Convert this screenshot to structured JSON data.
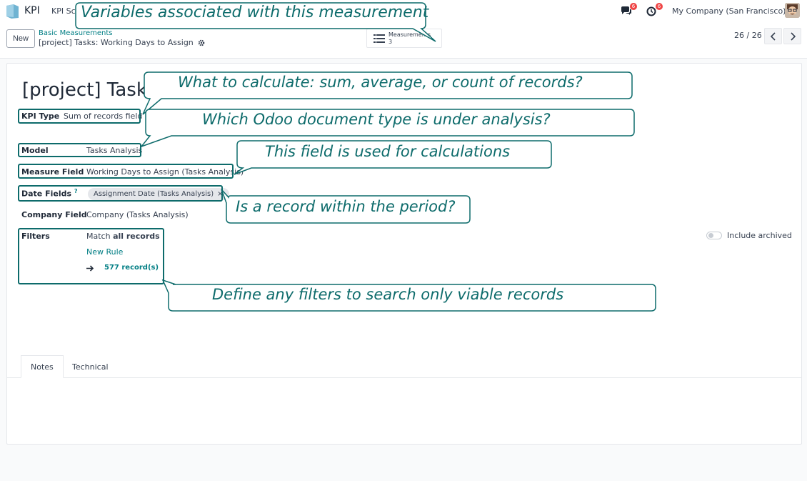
{
  "navbar": {
    "app_name": "KPI",
    "menu_label": "KPI Sc",
    "messages_count": "6",
    "activities_count": "6",
    "company": "My Company (San Francisco)"
  },
  "control": {
    "new_label": "New",
    "breadcrumb_parent": "Basic Measurements",
    "breadcrumb_current": "[project] Tasks: Working Days to Assign",
    "smart_button_label": "Measurements",
    "smart_button_value": "3",
    "pager": "26 / 26"
  },
  "form": {
    "title": "[project] Tasks",
    "kpi_type_label": "KPI Type",
    "kpi_type_value": "Sum of records field",
    "model_label": "Model",
    "model_value": "Tasks Analysis",
    "measure_field_label": "Measure Field",
    "measure_field_value": "Working Days to Assign (Tasks Analysis)",
    "date_fields_label": "Date Fields",
    "date_fields_help": "?",
    "date_fields_tag": "Assignment Date (Tasks Analysis)",
    "tag_remove": "×",
    "company_field_label": "Company Field",
    "company_field_value": "Company (Tasks Analysis)",
    "filters_label": "Filters",
    "filters_match_prefix": "Match",
    "filters_match_bold": "all records",
    "new_rule": "New Rule",
    "record_count": "577 record(s)",
    "include_archived": "Include archived"
  },
  "tabs": [
    {
      "label": "Notes"
    },
    {
      "label": "Technical"
    }
  ],
  "callouts": {
    "variables": "Variables associated with this measurement",
    "what_to_calc": "What to calculate: sum, average, or count of records?",
    "doc_type": "Which Odoo document type is under analysis?",
    "field_used": "This field is used for calculations",
    "period": "Is a record within the period?",
    "filters": "Define any filters to search only viable records"
  },
  "colors": {
    "accent": "#017e84",
    "callout": "#0d6b6b",
    "badge": "#ef4444"
  }
}
